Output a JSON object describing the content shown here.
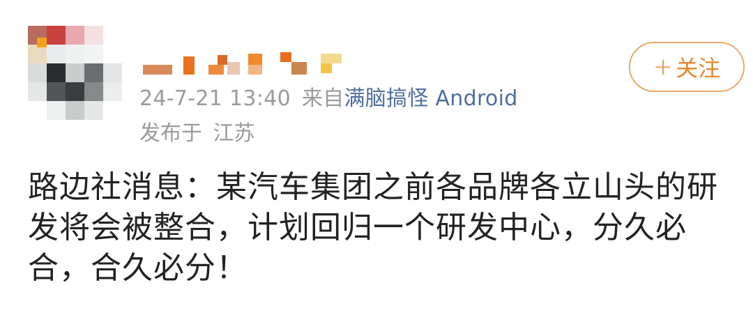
{
  "post": {
    "avatar": {
      "icon": "user-avatar-mosaic"
    },
    "username": {
      "icon": "username-mosaic"
    },
    "timestamp": "24-7-21 13:40",
    "source_prefix": "来自",
    "source_app": "满脑搞怪 Android",
    "location_prefix": "发布于",
    "location": "江苏",
    "follow_label": "关注",
    "follow_icon": "+",
    "body": "路边社消息：某汽车集团之前各品牌各立山头的研发将会被整合，计划回归一个研发中心，分久必合，合久必分！"
  },
  "colors": {
    "accent_orange": "#e8852d",
    "follow_border": "#e9a96d",
    "meta_gray": "#9a9a9a",
    "link_blue": "#4e6e9b",
    "text_dark": "#222222"
  }
}
